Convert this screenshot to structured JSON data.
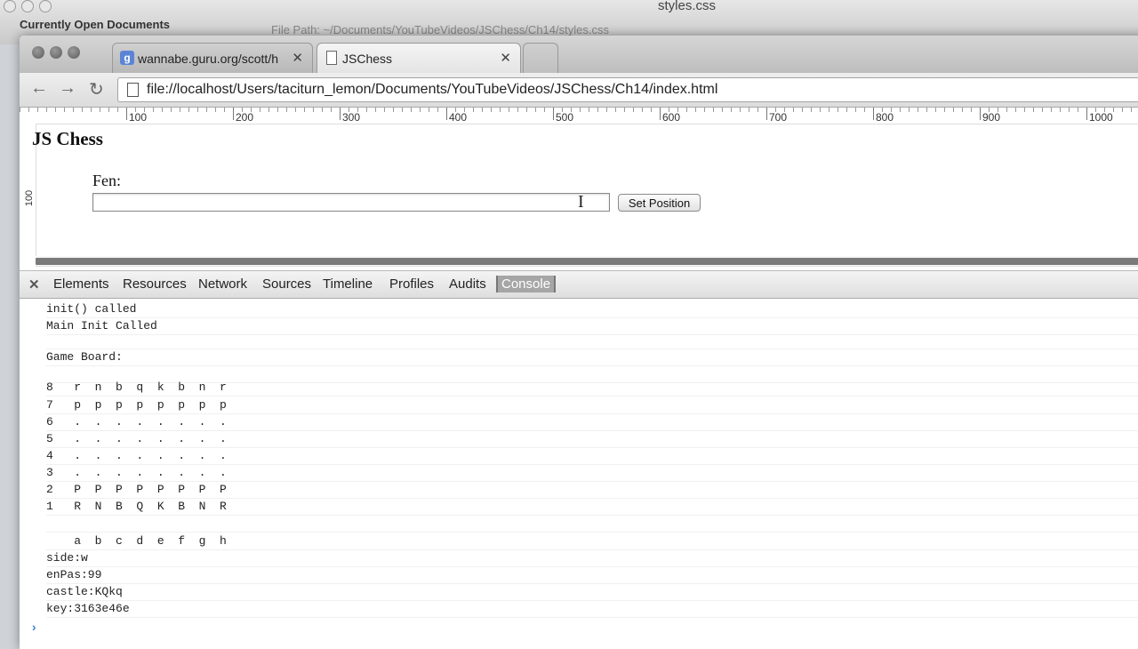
{
  "background_window": {
    "sidebar_title": "Currently Open Documents",
    "center_title": "styles.css",
    "file_path": "File Path: ~/Documents/YouTubeVideos/JSChess/Ch14/styles.css"
  },
  "browser": {
    "tabs": [
      {
        "label": "wannabe.guru.org/scott/h",
        "favicon": "g-favicon-icon"
      },
      {
        "label": "JSChess",
        "favicon": "page-icon"
      }
    ],
    "url": "file://localhost/Users/taciturn_lemon/Documents/YouTubeVideos/JSChess/Ch14/index.html"
  },
  "ruler": {
    "h_labels": [
      "100",
      "200",
      "300",
      "400",
      "500",
      "600",
      "700",
      "800",
      "900",
      "1000"
    ],
    "v_label": "100"
  },
  "page": {
    "title": "JS Chess",
    "fen_label": "Fen:",
    "fen_value": "",
    "set_button": "Set Position"
  },
  "devtools": {
    "tabs": [
      "Elements",
      "Resources",
      "Network",
      "Sources",
      "Timeline",
      "Profiles",
      "Audits",
      "Console"
    ],
    "active_tab": "Console",
    "console_lines": [
      "init() called",
      "Main Init Called",
      "",
      "Game Board:",
      "",
      "8   r  n  b  q  k  b  n  r",
      "7   p  p  p  p  p  p  p  p",
      "6   .  .  .  .  .  .  .  .",
      "5   .  .  .  .  .  .  .  .",
      "4   .  .  .  .  .  .  .  .",
      "3   .  .  .  .  .  .  .  .",
      "2   P  P  P  P  P  P  P  P",
      "1   R  N  B  Q  K  B  N  R",
      "",
      "    a  b  c  d  e  f  g  h",
      "side:w",
      "enPas:99",
      "castle:KQkq",
      "key:3163e46e"
    ],
    "prompt": "›"
  }
}
